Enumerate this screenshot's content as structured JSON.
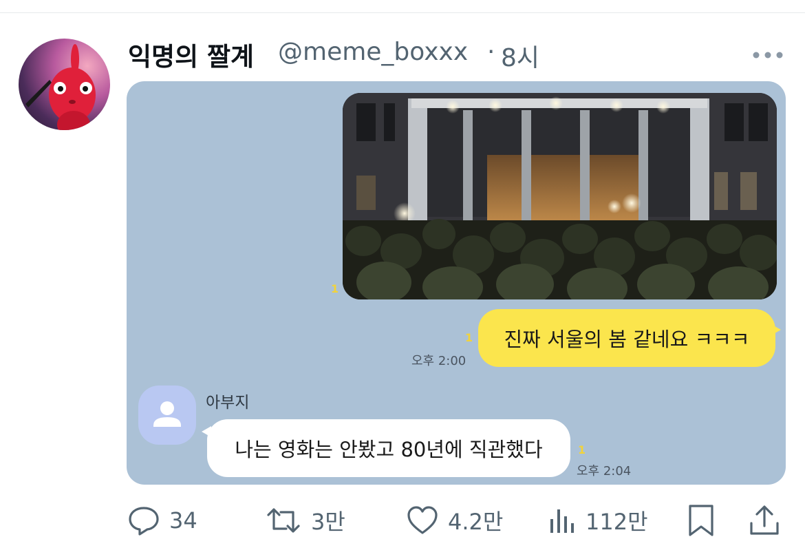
{
  "tweet": {
    "display_name": "익명의 짤계",
    "handle": "@meme_boxxx",
    "separator": "·",
    "time": "8시"
  },
  "chat": {
    "messages_me": [
      {
        "read_count": "1"
      },
      {
        "text": "진짜 서울의 봄 같네요 ㅋㅋㅋ",
        "read_count": "1",
        "time": "오후 2:00"
      }
    ],
    "contact": {
      "name": "아부지",
      "message": "나는 영화는 안봤고 80년에 직관했다",
      "read_count": "1",
      "time": "오후 2:04"
    }
  },
  "actions": {
    "replies": "34",
    "retweets": "3만",
    "likes": "4.2만",
    "views": "112만"
  },
  "colors": {
    "chat_background": "#abc1d6",
    "my_bubble": "#fbe54d",
    "other_bubble": "#ffffff",
    "icon_gray": "#536471",
    "read_count": "#f2d33a"
  },
  "icons": [
    "more-icon",
    "reply-icon",
    "retweet-icon",
    "like-icon",
    "views-icon",
    "bookmark-icon",
    "share-icon",
    "person-icon"
  ]
}
